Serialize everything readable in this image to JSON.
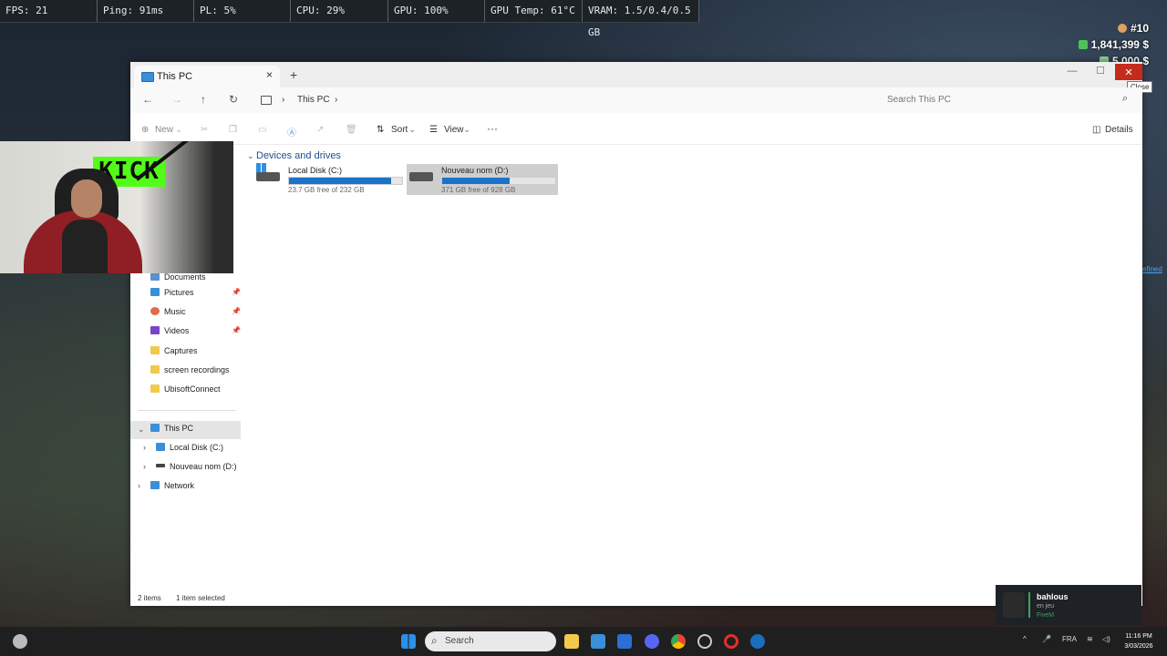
{
  "hud": {
    "fps": "FPS: 21",
    "ping": "Ping: 91ms",
    "pl": "PL: 5%",
    "cpu": "CPU: 29%",
    "gpu": "GPU: 100%",
    "gpu_temp": "GPU Temp: 61°C",
    "vram": "VRAM: 1.5/0.4/0.5 GB"
  },
  "stats": {
    "rank": "#10",
    "money": "1,841,399 $",
    "bank": "5,000 $"
  },
  "window": {
    "tab_title": "This PC",
    "tab_close": "×",
    "new_tab": "+",
    "min": "—",
    "max": "☐",
    "close": "✕",
    "close_tooltip": "Close"
  },
  "address": {
    "back": "←",
    "forward": "→",
    "up": "↑",
    "refresh": "↻",
    "crumb": "This PC",
    "chevron": "›",
    "search_placeholder": "Search This PC",
    "search_icon": "⌕"
  },
  "commandbar": {
    "new": "New",
    "sort": "Sort",
    "view": "View",
    "more": "···",
    "details": "Details"
  },
  "nav": {
    "documents": "Documents",
    "pictures": "Pictures",
    "music": "Music",
    "videos": "Videos",
    "captures": "Captures",
    "screen_recordings": "screen recordings",
    "ubisoft": "UbisoftConnect",
    "this_pc": "This PC",
    "local_disk": "Local Disk (C:)",
    "nouveau": "Nouveau nom (D:)",
    "network": "Network"
  },
  "content": {
    "group_label": "Devices and drives",
    "drives": [
      {
        "name": "Local Disk (C:)",
        "free": "23.7 GB free of 232 GB",
        "used_fraction": 0.9
      },
      {
        "name": "Nouveau nom (D:)",
        "free": "371 GB free of 928 GB",
        "used_fraction": 0.6
      }
    ]
  },
  "statusbar": {
    "items": "2 items",
    "selected": "1 item selected"
  },
  "webcam": {
    "logo": "KICK"
  },
  "notification": {
    "user": "bahlous",
    "status": "en jeu",
    "game": "FiveM"
  },
  "overlay_link": "efined",
  "taskbar": {
    "search_placeholder": "Search",
    "lang": "FRA",
    "time": "11:16 PM",
    "date": "3/03/2026"
  },
  "colors": {
    "accent": "#1a73c9",
    "close_red": "#c42b1c",
    "kick_green": "#53fc18"
  }
}
